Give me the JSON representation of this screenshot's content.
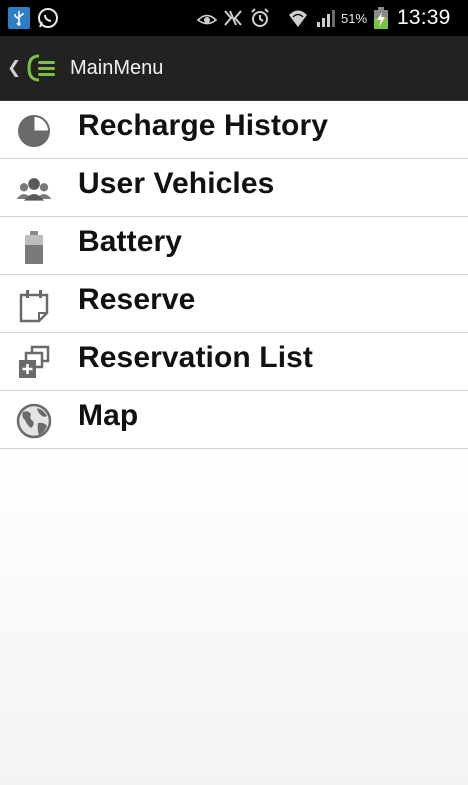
{
  "status_bar": {
    "battery_percent": "51%",
    "time": "13:39",
    "icons": [
      "usb-icon",
      "whatsapp-icon",
      "eye-icon",
      "nfc-icon",
      "alarm-icon",
      "wifi-icon",
      "signal-icon",
      "battery-charging-icon"
    ]
  },
  "action_bar": {
    "title": "MainMenu",
    "icons": [
      "back-chevron-icon",
      "app-logo-icon"
    ]
  },
  "menu": {
    "items": [
      {
        "label": "Recharge History",
        "icon": "clock-icon"
      },
      {
        "label": "User Vehicles",
        "icon": "users-icon"
      },
      {
        "label": "Battery",
        "icon": "battery-icon"
      },
      {
        "label": "Reserve",
        "icon": "calendar-icon"
      },
      {
        "label": "Reservation List",
        "icon": "add-to-list-icon"
      },
      {
        "label": "Map",
        "icon": "globe-icon"
      }
    ]
  },
  "colors": {
    "status_bar_bg": "#000000",
    "action_bar_bg": "#222222",
    "accent_green": "#7cc242",
    "usb_blue": "#2b7fc5",
    "icon_gray": "#6a6a6a"
  }
}
